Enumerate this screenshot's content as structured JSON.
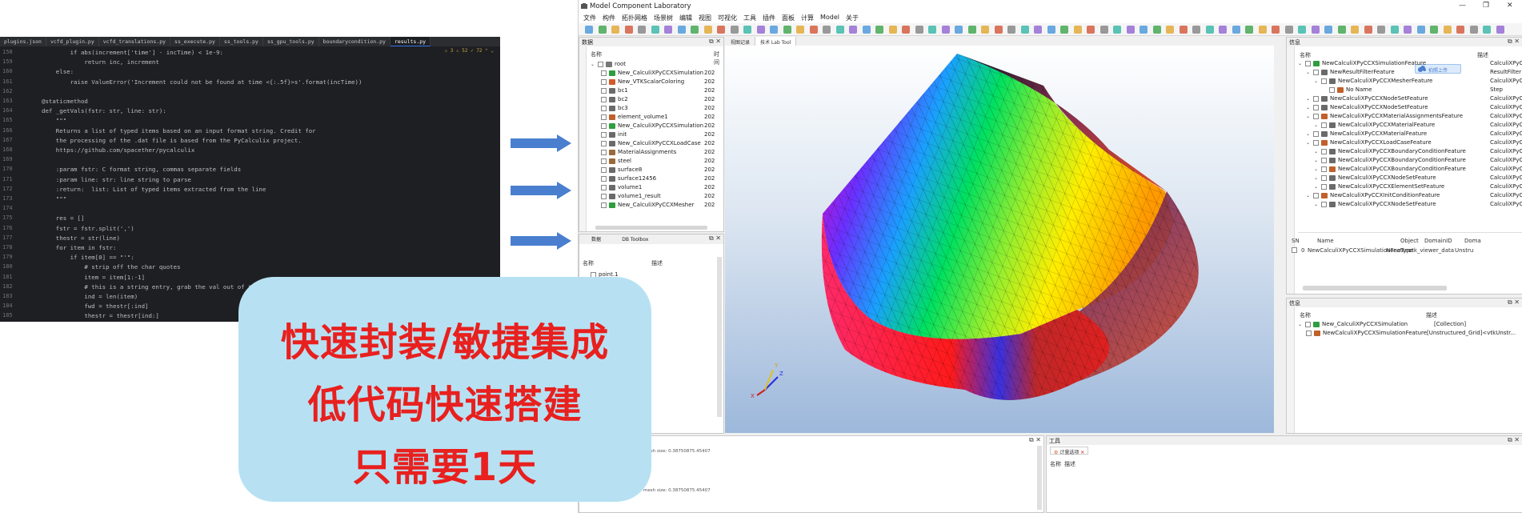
{
  "editor": {
    "tabs": [
      "plugins.json",
      "vcfd_plugin.py",
      "vcfd_translations.py",
      "ss_execute.py",
      "ss_tools.py",
      "ss_gpu_tools.py",
      "boundarycondition.py",
      "results.py"
    ],
    "status": "⚠ 3  ⚠ 52  ✓ 72  ⌃ ⌄",
    "line_numbers": [
      "158",
      "159",
      "160",
      "161",
      "162",
      "163",
      "164",
      "165",
      "166",
      "167",
      "168",
      "169",
      "170",
      "171",
      "172",
      "173",
      "174",
      "175",
      "176",
      "177",
      "178",
      "179",
      "180",
      "181",
      "182",
      "183",
      "184",
      "185"
    ],
    "lines": [
      "        if abs(increment['time'] - incTime) < 1e-9:",
      "            return inc, increment",
      "    else:",
      "        raise ValueError('Increment could not be found at time <{:.5f}>s'.format(incTime))",
      "",
      "@staticmethod",
      "def _getVals(fstr: str, line: str):",
      "    \"\"\"",
      "    Returns a list of typed items based on an input format string. Credit for",
      "    the processing of the .dat file is based from the PyCalculix project.",
      "    https://github.com/spacether/pycalculix",
      "",
      "    :param fstr: C format string, commas separate fields",
      "    :param line: str: line string to parse",
      "    :return:  list: List of typed items extracted from the line",
      "    \"\"\"",
      "",
      "    res = []",
      "    fstr = fstr.split(',')",
      "    thestr = str(line)",
      "    for item in fstr:",
      "        if item[0] == \"'\":",
      "            # strip off the char quotes",
      "            item = item[1:-1]",
      "            # this is a string entry, grab the val out of t",
      "            ind = len(item)",
      "            fwd = thestr[:ind]",
      "            thestr = thestr[ind:]"
    ]
  },
  "app": {
    "title": "Model Component Laboratory",
    "window_buttons": [
      "—",
      "❐",
      "✕"
    ],
    "menu": [
      "文件",
      "构件",
      "拓扑网格",
      "场景树",
      "编辑",
      "视图",
      "可视化",
      "工具",
      "插件",
      "面板",
      "计算",
      "Model",
      "关于"
    ],
    "data_panel": {
      "title": "数据",
      "col_name": "名称",
      "col_time": "时间",
      "root": "root",
      "items": [
        {
          "name": "New_CalculiXPyCCXSimulation",
          "time": "202",
          "color": "#2e9e3e"
        },
        {
          "name": "New_VTKScalarColoring",
          "time": "202",
          "color": "#d25b2a"
        },
        {
          "name": "bc1",
          "time": "202",
          "color": "#6a6a6a"
        },
        {
          "name": "bc2",
          "time": "202",
          "color": "#6a6a6a"
        },
        {
          "name": "bc3",
          "time": "202",
          "color": "#6a6a6a"
        },
        {
          "name": "element_volume1",
          "time": "202",
          "color": "#c0602a"
        },
        {
          "name": "New_CalculiXPyCCXSimulation",
          "time": "202",
          "color": "#2e9e3e"
        },
        {
          "name": "init",
          "time": "202",
          "color": "#6a6a6a"
        },
        {
          "name": "New_CalculiXPyCCXLoadCase",
          "time": "202",
          "color": "#6a6a6a"
        },
        {
          "name": "MaterialAssignments",
          "time": "202",
          "color": "#9a6a3a"
        },
        {
          "name": "steel",
          "time": "202",
          "color": "#9a6a3a"
        },
        {
          "name": "surface8",
          "time": "202",
          "color": "#6a6a6a"
        },
        {
          "name": "surface12456",
          "time": "202",
          "color": "#6a6a6a"
        },
        {
          "name": "volume1",
          "time": "202",
          "color": "#6a6a6a"
        },
        {
          "name": "volume1_result",
          "time": "202",
          "color": "#6a6a6a"
        },
        {
          "name": "New_CalculiXPyCCXMesher",
          "time": "202",
          "color": "#2e9e3e"
        }
      ]
    },
    "point_panel": {
      "tabs": [
        "数据",
        "DB Toolbox"
      ],
      "col_name": "名称",
      "col_desc": "描述",
      "items": [
        "point.1"
      ]
    },
    "viewport_tabs": [
      "视图记录",
      "技术 Lab Tool"
    ],
    "info_panel": {
      "title": "信息",
      "col_name": "名称",
      "col_desc": "描述",
      "badge": "拍照上传",
      "items": [
        {
          "depth": 0,
          "name": "NewCalculiXPyCCXSimulationFeature",
          "desc": "CalculiXPyCCXSi..."
        },
        {
          "depth": 1,
          "name": "NewResultFilterFeature",
          "desc": "ResultFilter"
        },
        {
          "depth": 2,
          "name": "NewCalculiXPyCCXMesherFeature",
          "desc": "CalculiXPyCCXMe..."
        },
        {
          "depth": 3,
          "name": "No Name",
          "desc": "Step"
        },
        {
          "depth": 1,
          "name": "NewCalculiXPyCCXNodeSetFeature",
          "desc": "CalculiXPyCCXNo..."
        },
        {
          "depth": 1,
          "name": "NewCalculiXPyCCXNodeSetFeature",
          "desc": "CalculiXPyCCXNo..."
        },
        {
          "depth": 1,
          "name": "NewCalculiXPyCCXMaterialAssignmentsFeature",
          "desc": "CalculiXPyCCXMa..."
        },
        {
          "depth": 2,
          "name": "NewCalculiXPyCCXMaterialFeature",
          "desc": "CalculiXPyCCXMa..."
        },
        {
          "depth": 1,
          "name": "NewCalculiXPyCCXMaterialFeature",
          "desc": "CalculiXPyCCXMa..."
        },
        {
          "depth": 1,
          "name": "NewCalculiXPyCCXLoadCaseFeature",
          "desc": "CalculiXPyCCXLo..."
        },
        {
          "depth": 2,
          "name": "NewCalculiXPyCCXBoundaryConditionFeature",
          "desc": "CalculiXPyCCXBo..."
        },
        {
          "depth": 2,
          "name": "NewCalculiXPyCCXBoundaryConditionFeature",
          "desc": "CalculiXPyCCXBo..."
        },
        {
          "depth": 2,
          "name": "NewCalculiXPyCCXBoundaryConditionFeature",
          "desc": "CalculiXPyCCXBo..."
        },
        {
          "depth": 2,
          "name": "NewCalculiXPyCCXNodeSetFeature",
          "desc": "CalculiXPyCCXNo..."
        },
        {
          "depth": 2,
          "name": "NewCalculiXPyCCXElementSetFeature",
          "desc": "CalculiXPyCCXEle..."
        },
        {
          "depth": 1,
          "name": "NewCalculiXPyCCXInitConditionFeature",
          "desc": "CalculiXPyCCXInit..."
        },
        {
          "depth": 2,
          "name": "NewCalculiXPyCCXNodeSetFeature",
          "desc": "CalculiXPyCCXNo..."
        }
      ],
      "table_headers": [
        "SN",
        "Name",
        "Object",
        "DomainID",
        "Doma"
      ],
      "table_row": [
        "0",
        "NewCalculiXPyCCXSimulationFeature",
        "NoneType",
        "vtk_viewer_data",
        "Unstru"
      ]
    },
    "info2_panel": {
      "title": "信息",
      "col_name": "名称",
      "col_desc": "描述",
      "items": [
        {
          "name": "New_CalculiXPyCCXSimulation",
          "desc": "[Collection]"
        },
        {
          "name": "NewCalculiXPyCCXSimulationFeature",
          "desc": "[Unstructured_Grid]<vtkUnstr..."
        }
      ]
    },
    "log_panel": {
      "lines": [
        "mesh size: 0.38750875.45407",
        "mesh size: 0.38750875.45407"
      ]
    },
    "tools_panel": {
      "title": "工具",
      "tab": "计量选项",
      "col_name": "名称",
      "col_desc": "描述"
    },
    "axes": {
      "x": "X",
      "y": "Y",
      "z": "Z"
    }
  },
  "overlay": {
    "line1": "快速封装/敏捷集成",
    "line2": "低代码快速搭建",
    "line3": "只需要1天"
  },
  "colors": {
    "arrow": "#4a7fcf",
    "overlay_bg": "#b7e1f3",
    "overlay_text": "#e8201e"
  }
}
